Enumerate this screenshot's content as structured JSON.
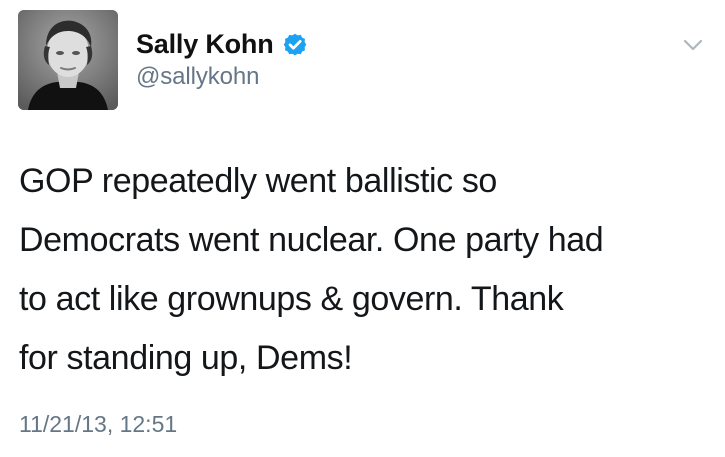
{
  "tweet": {
    "author": {
      "display_name": "Sally Kohn",
      "handle": "@sallykohn",
      "verified": true
    },
    "text": "GOP repeatedly went ballistic so\nDemocrats went nuclear. One party had\nto act like grownups & govern. Thank\nfor standing up, Dems!",
    "timestamp": "11/21/13, 12:51"
  },
  "icons": {
    "verified": "verified-badge-icon",
    "menu": "chevron-down-icon",
    "avatar": "profile-photo"
  },
  "colors": {
    "text_primary": "#14171a",
    "text_secondary": "#657786",
    "verified_blue": "#1da1f2",
    "chevron_gray": "#aab8c2"
  }
}
